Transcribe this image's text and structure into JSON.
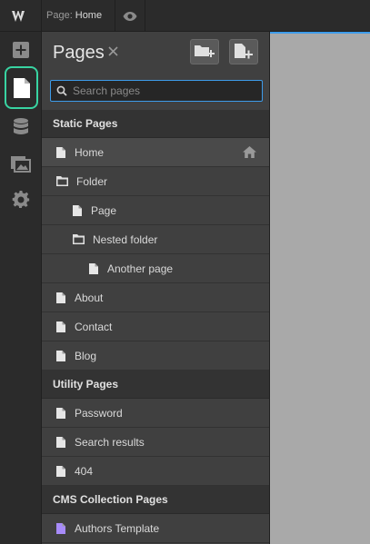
{
  "topbar": {
    "page_label": "Page:",
    "page_value": "Home"
  },
  "rail": {
    "icons": [
      "add-icon",
      "pages-icon",
      "cms-icon",
      "assets-icon",
      "settings-icon"
    ],
    "active_color": "#38d4a2"
  },
  "panel": {
    "title": "Pages",
    "search_placeholder": "Search pages",
    "sections": [
      {
        "title": "Static Pages",
        "items": [
          {
            "label": "Home",
            "type": "page",
            "level": 0,
            "selected": true,
            "home": true
          },
          {
            "label": "Folder",
            "type": "folder",
            "level": 0
          },
          {
            "label": "Page",
            "type": "page",
            "level": 1
          },
          {
            "label": "Nested folder",
            "type": "folder",
            "level": 1
          },
          {
            "label": "Another page",
            "type": "page",
            "level": 2
          },
          {
            "label": "About",
            "type": "page",
            "level": 0
          },
          {
            "label": "Contact",
            "type": "page",
            "level": 0
          },
          {
            "label": "Blog",
            "type": "page",
            "level": 0
          }
        ]
      },
      {
        "title": "Utility Pages",
        "items": [
          {
            "label": "Password",
            "type": "page",
            "level": 0
          },
          {
            "label": "Search results",
            "type": "page",
            "level": 0
          },
          {
            "label": "404",
            "type": "page",
            "level": 0
          }
        ]
      },
      {
        "title": "CMS Collection Pages",
        "items": [
          {
            "label": "Authors Template",
            "type": "cms-page",
            "level": 0
          }
        ]
      }
    ]
  },
  "colors": {
    "accent": "#3d9be9",
    "cms_page": "#a78bfa"
  }
}
